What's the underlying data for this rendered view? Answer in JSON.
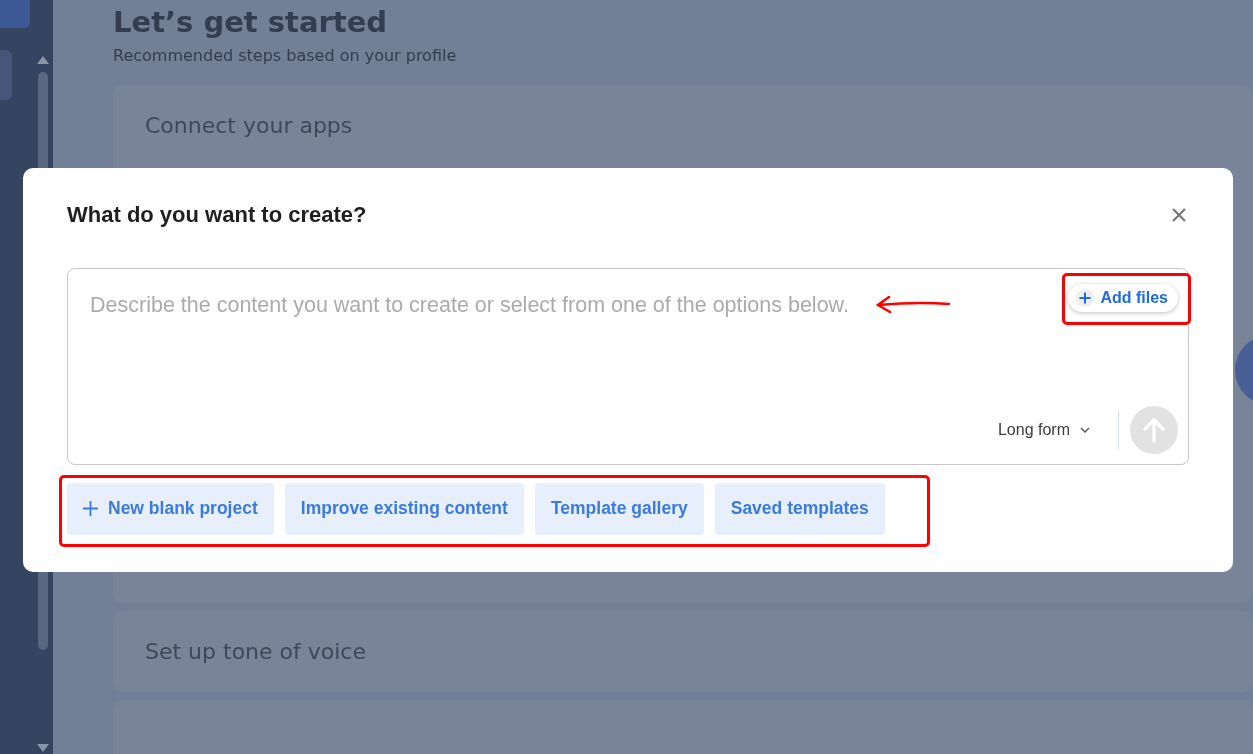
{
  "page": {
    "title": "Let’s get started",
    "subtitle": "Recommended steps based on your profile",
    "steps": [
      {
        "title": "Connect your apps"
      },
      {
        "title": "Set up tone of voice"
      }
    ]
  },
  "dialog": {
    "title": "What do you want to create?",
    "prompt": {
      "placeholder": "Describe the content you want to create or select from one of the options below."
    },
    "add_files": "Add files",
    "format": "Long form",
    "actions": [
      {
        "label": "New blank project",
        "kind": "new"
      },
      {
        "label": "Improve existing content",
        "kind": "plain"
      },
      {
        "label": "Template gallery",
        "kind": "plain"
      },
      {
        "label": "Saved templates",
        "kind": "plain"
      }
    ]
  }
}
